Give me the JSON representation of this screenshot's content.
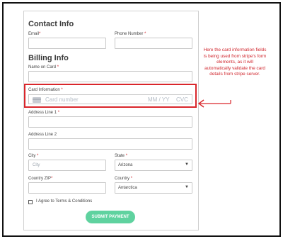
{
  "contact": {
    "heading": "Contact Info",
    "email_label": "Email",
    "email_required": "*",
    "phone_label": "Phone Number",
    "phone_required": "*"
  },
  "billing": {
    "heading": "Billing Info",
    "name_label": "Name on Card",
    "name_required": "*",
    "card_label": "Card Information",
    "card_required": "*",
    "card_number_placeholder": "Card number",
    "card_expiry_placeholder": "MM / YY",
    "card_cvc_placeholder": "CVC",
    "address1_label": "Address Line 1",
    "address1_required": "*",
    "address2_label": "Address Line 2",
    "city_label": "City",
    "city_required": "*",
    "city_placeholder": "City",
    "state_label": "State",
    "state_required": "*",
    "state_value": "Arizona",
    "zip_label": "Country ZIP",
    "zip_required": "*",
    "country_label": "Country",
    "country_required": "*",
    "country_value": "Antarctica",
    "terms_label": "I Agree to Terms & Conditions",
    "submit_label": "SUBMIT PAYMENT"
  },
  "annotation": {
    "text": "Here the card information fields is being used from stripe's form elements, as it will automatically validate the card details from stripe server."
  },
  "icons": {
    "card": "credit-card-icon",
    "dropdown": "chevron-down-icon",
    "arrow": "left-arrow-icon"
  },
  "colors": {
    "required": "#d0262d",
    "highlight": "#d9262b",
    "submit": "#5fd29f",
    "annotation": "#d0262d"
  }
}
